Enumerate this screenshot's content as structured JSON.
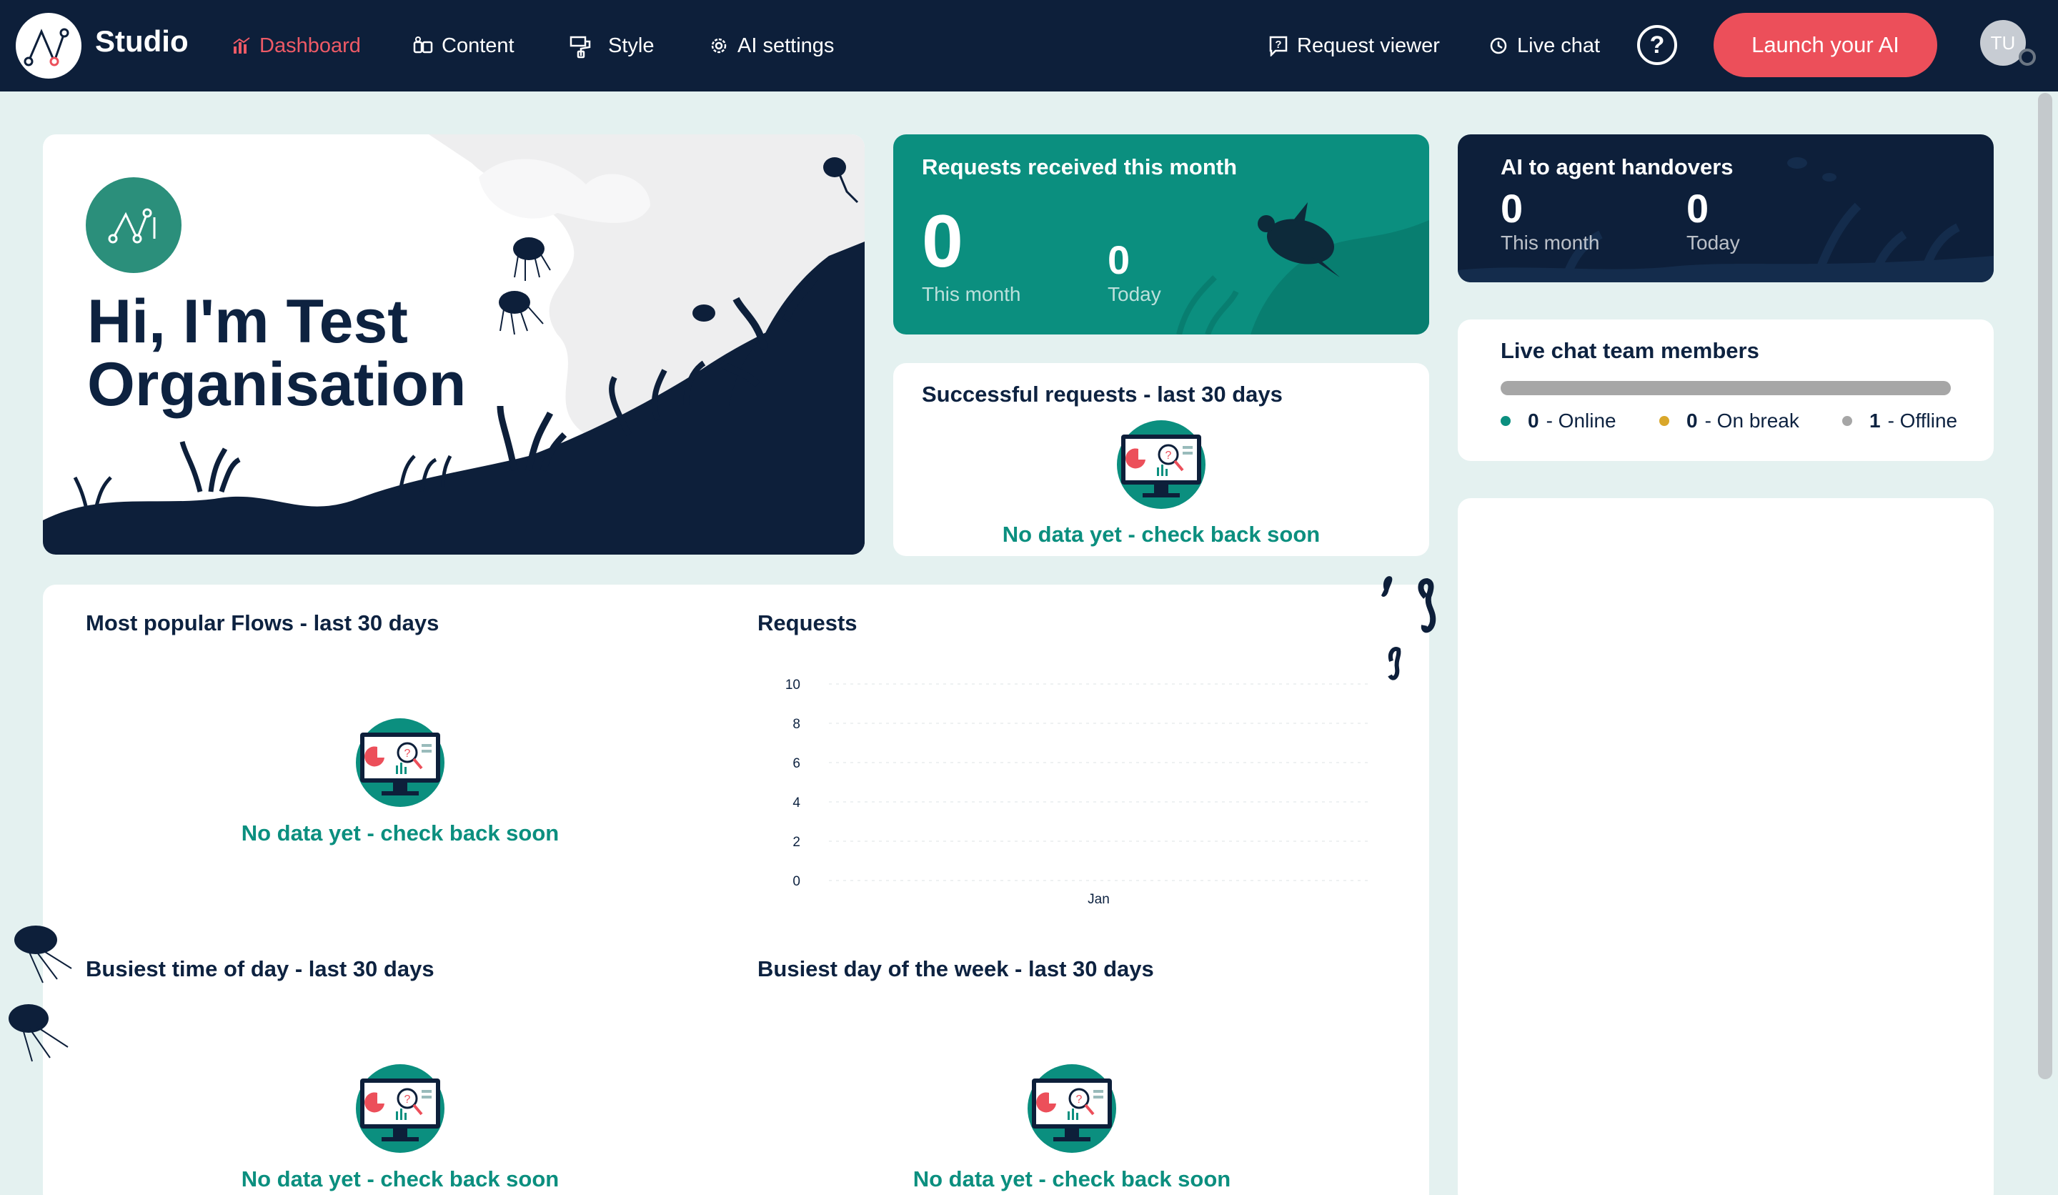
{
  "topbar": {
    "brand": "Studio",
    "nav": [
      {
        "label": "Dashboard",
        "icon": "bar-chart-icon",
        "active": true
      },
      {
        "label": "Content",
        "icon": "content-icon"
      },
      {
        "label": "Style",
        "icon": "style-icon"
      },
      {
        "label": "AI settings",
        "icon": "gear-icon"
      }
    ],
    "right_nav": [
      {
        "label": "Request viewer",
        "icon": "request-viewer-icon"
      },
      {
        "label": "Live chat",
        "icon": "live-chat-icon"
      }
    ],
    "help": "?",
    "launch_label": "Launch your AI",
    "avatar_initials": "TU"
  },
  "hello": {
    "title": "Hi, I'm Test Organisation"
  },
  "requests_month": {
    "title": "Requests received this month",
    "month_value": "0",
    "month_label": "This month",
    "today_value": "0",
    "today_label": "Today"
  },
  "handovers": {
    "title": "AI to agent handovers",
    "month_value": "0",
    "month_label": "This month",
    "today_value": "0",
    "today_label": "Today"
  },
  "successful": {
    "title": "Successful requests - last 30 days",
    "empty": "No data yet - check back soon"
  },
  "team": {
    "title": "Live chat team members",
    "online_count": "0",
    "online_label": "- Online",
    "break_count": "0",
    "break_label": "- On break",
    "offline_count": "1",
    "offline_label": "- Offline"
  },
  "popular_flows": {
    "title": "Most popular Flows - last 30 days",
    "empty": "No data yet - check back soon"
  },
  "busiest_time": {
    "title": "Busiest time of day - last 30 days",
    "empty": "No data yet - check back soon"
  },
  "busiest_day": {
    "title": "Busiest day of the week - last 30 days",
    "empty": "No data yet - check back soon"
  },
  "colors": {
    "navy": "#0d1f3a",
    "teal": "#0b8f7f",
    "coral": "#ec4f5a",
    "online": "#0b8f7f",
    "break": "#d9a72b",
    "offline": "#a6a6a6"
  },
  "chart_data": {
    "type": "line",
    "title": "Requests",
    "categories": [
      "Jan"
    ],
    "series": [
      {
        "values": [
          0
        ]
      }
    ],
    "yticks": [
      "10",
      "8",
      "6",
      "4",
      "2",
      "0"
    ],
    "ylim": [
      0,
      10
    ],
    "grid": true
  }
}
